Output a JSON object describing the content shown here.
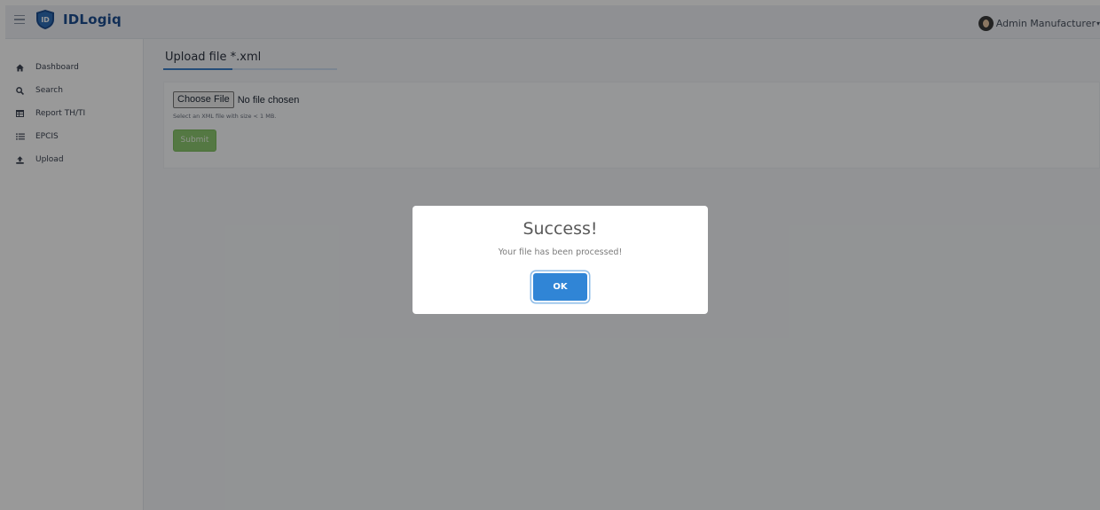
{
  "header": {
    "brand": "IDLogiq",
    "logo_text": "ID",
    "user_name": "Admin Manufacturer"
  },
  "sidebar": {
    "items": [
      {
        "label": "Dashboard",
        "icon": "home-icon"
      },
      {
        "label": "Search",
        "icon": "search-icon"
      },
      {
        "label": "Report TH/TI",
        "icon": "table-icon"
      },
      {
        "label": "EPCIS",
        "icon": "list-icon"
      },
      {
        "label": "Upload",
        "icon": "upload-icon"
      }
    ]
  },
  "main": {
    "title": "Upload file *.xml",
    "choose_file_label": "Choose File",
    "no_file_text": "No file chosen",
    "hint": "Select an XML file with size < 1 MB.",
    "submit_label": "Submit"
  },
  "modal": {
    "title": "Success!",
    "message": "Your file has been processed!",
    "ok_label": "OK"
  },
  "colors": {
    "brand": "#1d4e8f",
    "accent": "#3085d6",
    "submit": "#8dc971"
  }
}
